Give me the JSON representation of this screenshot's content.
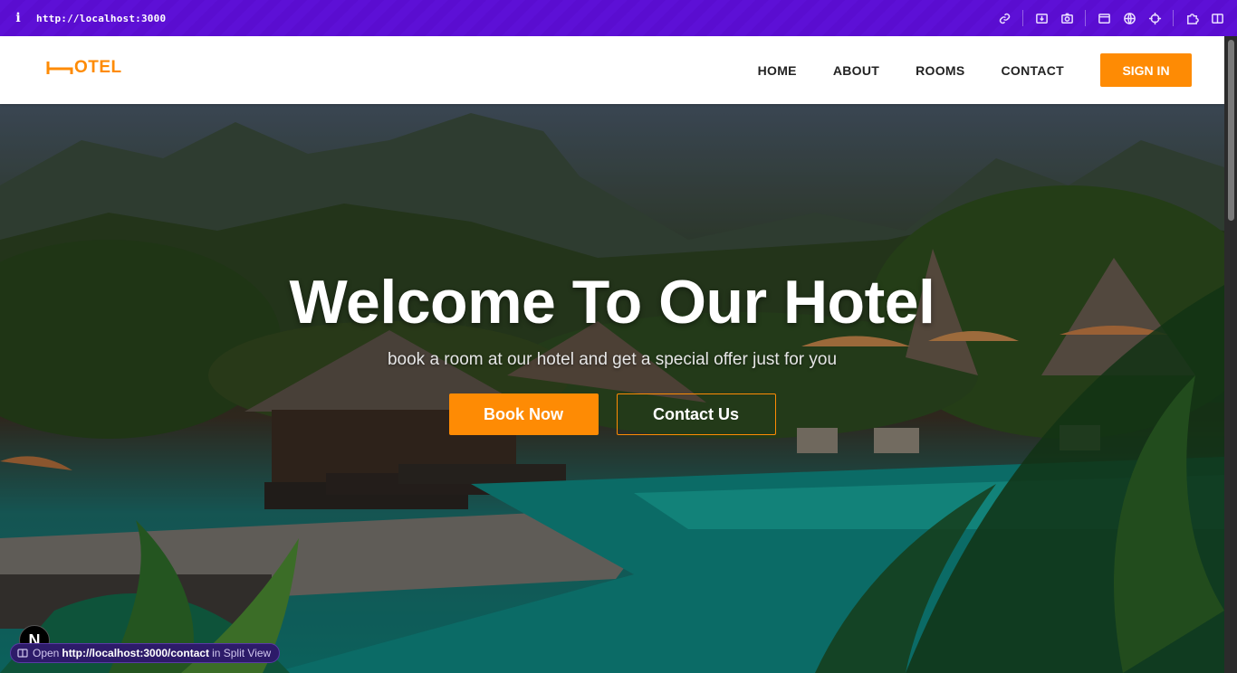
{
  "browser": {
    "url": "http://localhost:3000",
    "info_glyph": "i",
    "tool_icons": [
      "link-icon",
      "inspect-icon",
      "camera-icon",
      "terminal-icon",
      "globe-icon",
      "crosshair-icon",
      "extensions-icon",
      "split-view-icon"
    ]
  },
  "navbar": {
    "logo_text": "OTEL",
    "links": [
      "HOME",
      "ABOUT",
      "ROOMS",
      "CONTACT"
    ],
    "signin_label": "SIGN IN"
  },
  "hero": {
    "title": "Welcome To Our Hotel",
    "subtitle": "book a room at our hotel and get a special offer just for you",
    "book_label": "Book Now",
    "contact_label": "Contact Us"
  },
  "overlay": {
    "next_badge": "N",
    "status_prefix": "Open",
    "status_url": "http://localhost:3000/contact",
    "status_suffix": "in Split View"
  },
  "colors": {
    "accent": "#fe8b04",
    "chrome": "#5d10d6"
  }
}
